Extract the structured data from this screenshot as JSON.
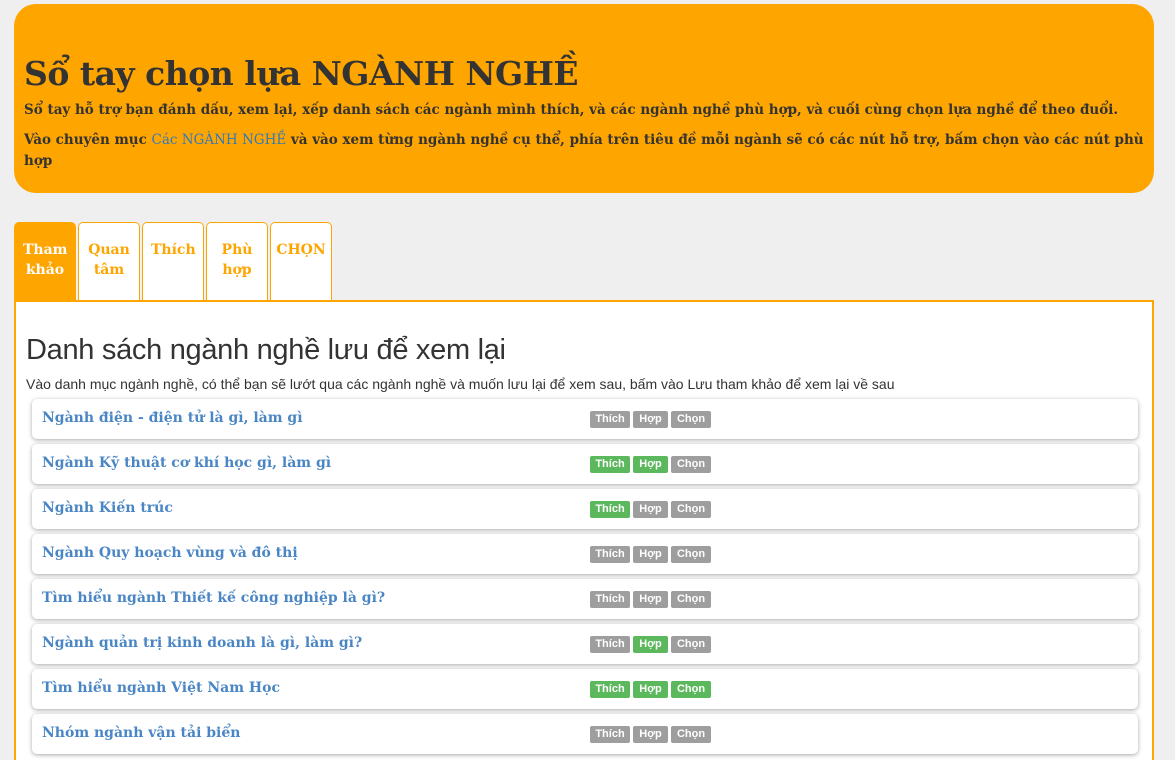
{
  "hero": {
    "title": "Sổ tay chọn lựa NGÀNH NGHỀ",
    "line1": "Sổ tay hỗ trợ bạn đánh dấu, xem lại, xếp danh sách các ngành mình thích, và các ngành nghề phù hợp, và cuối cùng chọn lựa nghề để theo đuổi.",
    "line2_pre": "Vào chuyên mục ",
    "line2_link": "Các NGÀNH NGHỀ",
    "line2_post": " và vào xem từng ngành nghề cụ thể, phía trên tiêu đề mỗi ngành sẽ có các nút hỗ trợ, bấm chọn vào các nút phù hợp"
  },
  "tabs": [
    {
      "label_1": "Tham",
      "label_2": "khảo"
    },
    {
      "label_1": "Quan",
      "label_2": "tâm"
    },
    {
      "label_1": "Thích",
      "label_2": ""
    },
    {
      "label_1": "Phù",
      "label_2": "hợp"
    },
    {
      "label_1": "CHỌN",
      "label_2": ""
    }
  ],
  "panel": {
    "heading": "Danh sách ngành nghề lưu để xem lại",
    "description": "Vào danh mục ngành nghề, có thể bạn sẽ lướt qua các ngành nghề và muốn lưu lại để xem sau, bấm vào Lưu tham khảo để xem lại về sau"
  },
  "buttons": {
    "like": "Thích",
    "fit": "Hợp",
    "choose": "Chọn"
  },
  "colors": {
    "accent": "#ffa500",
    "on": "#5cb85c",
    "off": "#9e9e9e",
    "link": "#4a86c4"
  },
  "items": [
    {
      "title": "Ngành điện - điện tử là gì, làm gì",
      "like": false,
      "fit": false,
      "choose": false
    },
    {
      "title": "Ngành Kỹ thuật cơ khí học gì, làm gì",
      "like": true,
      "fit": true,
      "choose": false
    },
    {
      "title": "Ngành Kiến trúc",
      "like": true,
      "fit": false,
      "choose": false
    },
    {
      "title": "Ngành Quy hoạch vùng và đô thị",
      "like": false,
      "fit": false,
      "choose": false
    },
    {
      "title": "Tìm hiểu ngành Thiết kế công nghiệp là gì?",
      "like": false,
      "fit": false,
      "choose": false
    },
    {
      "title": "Ngành quản trị kinh doanh là gì, làm gì?",
      "like": false,
      "fit": true,
      "choose": false
    },
    {
      "title": "Tìm hiểu ngành Việt Nam Học",
      "like": true,
      "fit": true,
      "choose": true
    },
    {
      "title": "Nhóm ngành vận tải biển",
      "like": false,
      "fit": false,
      "choose": false
    }
  ]
}
